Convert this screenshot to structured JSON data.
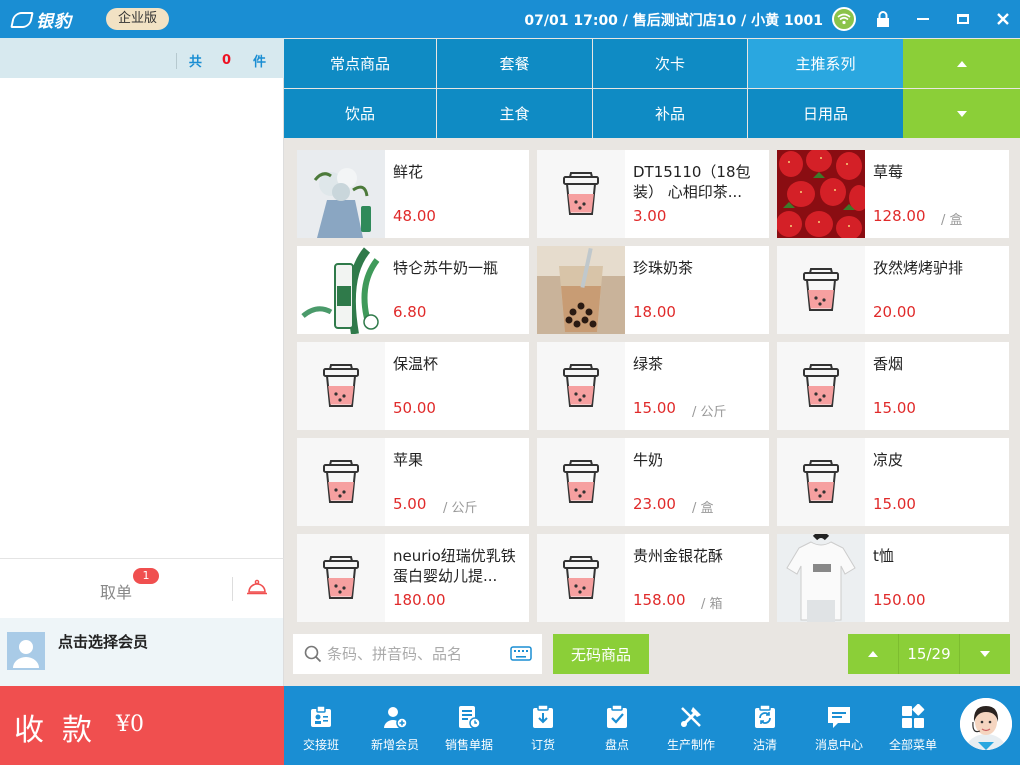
{
  "app": {
    "logo_text": "银豹",
    "edition": "企业版",
    "datetime": "07/01 17:00",
    "store": "售后测试门店10",
    "user": "小黄 1001"
  },
  "cart": {
    "count_prefix": "共",
    "count": "0",
    "count_suffix": "件",
    "take_order_label": "取单",
    "take_order_badge": "1",
    "member_label": "点击选择会员",
    "pay_label": "收款",
    "pay_amount": "¥0"
  },
  "categories": {
    "row1": [
      "常点商品",
      "套餐",
      "次卡",
      "主推系列"
    ],
    "row2": [
      "饮品",
      "主食",
      "补品",
      "日用品"
    ],
    "active": "主推系列"
  },
  "products": [
    {
      "name": "鲜花",
      "price": "48.00",
      "unit": "",
      "thumb": "flower-bouquet-photo"
    },
    {
      "name": "DT15110（18包装） 心相印茶...",
      "price": "3.00",
      "unit": "",
      "thumb": "cup-icon"
    },
    {
      "name": "草莓",
      "price": "128.00",
      "unit": "/ 盒",
      "thumb": "strawberry-photo"
    },
    {
      "name": "特仑苏牛奶一瓶",
      "price": "6.80",
      "unit": "",
      "thumb": "milk-bottle-photo"
    },
    {
      "name": "珍珠奶茶",
      "price": "18.00",
      "unit": "",
      "thumb": "bubble-tea-photo"
    },
    {
      "name": "孜然烤烤驴排",
      "price": "20.00",
      "unit": "",
      "thumb": "cup-icon"
    },
    {
      "name": "保温杯",
      "price": "50.00",
      "unit": "",
      "thumb": "cup-icon"
    },
    {
      "name": "绿茶",
      "price": "15.00",
      "unit": "/ 公斤",
      "thumb": "cup-icon"
    },
    {
      "name": "香烟",
      "price": "15.00",
      "unit": "",
      "thumb": "cup-icon"
    },
    {
      "name": "苹果",
      "price": "5.00",
      "unit": "/ 公斤",
      "thumb": "cup-icon"
    },
    {
      "name": "牛奶",
      "price": "23.00",
      "unit": "/ 盒",
      "thumb": "cup-icon"
    },
    {
      "name": "凉皮",
      "price": "15.00",
      "unit": "",
      "thumb": "cup-icon"
    },
    {
      "name": "neurio纽瑞优乳铁蛋白婴幼儿提...",
      "price": "180.00",
      "unit": "",
      "thumb": "cup-icon"
    },
    {
      "name": "贵州金银花酥",
      "price": "158.00",
      "unit": "/ 箱",
      "thumb": "cup-icon"
    },
    {
      "name": "t恤",
      "price": "150.00",
      "unit": "",
      "thumb": "tshirt-photo"
    }
  ],
  "search": {
    "placeholder": "条码、拼音码、品名",
    "value": ""
  },
  "no_code_label": "无码商品",
  "pager": {
    "current": "15",
    "total": "29"
  },
  "toolbar": [
    {
      "label": "交接班",
      "icon": "handover-icon"
    },
    {
      "label": "新增会员",
      "icon": "add-member-icon"
    },
    {
      "label": "销售单据",
      "icon": "sales-receipt-icon"
    },
    {
      "label": "订货",
      "icon": "order-goods-icon"
    },
    {
      "label": "盘点",
      "icon": "stocktake-icon"
    },
    {
      "label": "生产制作",
      "icon": "production-icon"
    },
    {
      "label": "沽清",
      "icon": "sold-out-icon"
    },
    {
      "label": "消息中心",
      "icon": "message-icon"
    },
    {
      "label": "全部菜单",
      "icon": "all-menu-icon"
    }
  ],
  "colors": {
    "brand_blue": "#1a8ed3",
    "category_blue": "#0f8bc4",
    "active_category": "#2aa7e0",
    "accent_green": "#8bcf38",
    "pay_red": "#f04f4f",
    "price_red": "#e02a2a"
  }
}
